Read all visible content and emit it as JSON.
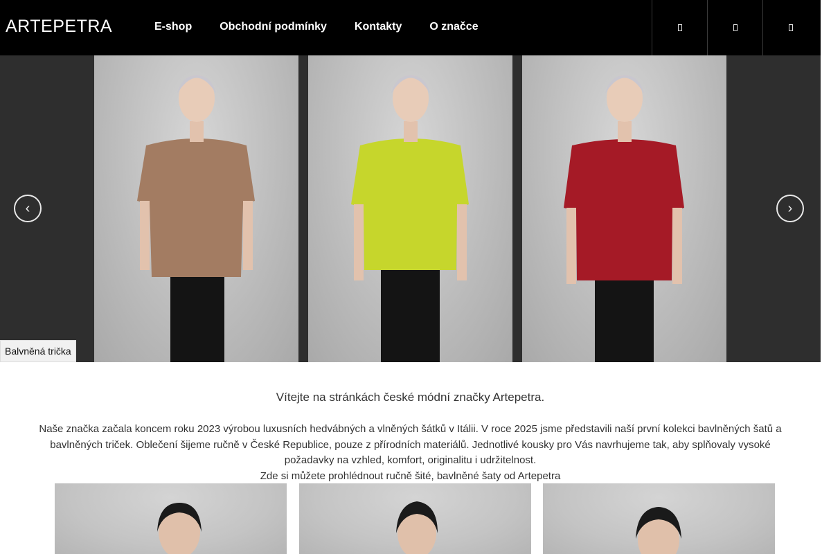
{
  "header": {
    "logo": "ARTEPETRA",
    "nav": [
      {
        "label": "E-shop"
      },
      {
        "label": "Obchodní podmínky"
      },
      {
        "label": "Kontakty"
      },
      {
        "label": "O značce"
      }
    ],
    "icons": [
      "search-icon",
      "user-icon",
      "cart-icon"
    ]
  },
  "slider": {
    "caption": "Balvněná trička",
    "prev_icon": "chevron-left-icon",
    "next_icon": "chevron-right-icon",
    "slides": [
      {
        "shirt_color": "#a37c62"
      },
      {
        "shirt_color": "#c6d62c"
      },
      {
        "shirt_color": "#a51a26"
      }
    ]
  },
  "content": {
    "welcome": "Vítejte na stránkách české módní značky Artepetra.",
    "intro": "Naše značka začala koncem roku 2023 výrobou luxusních hedvábných a vlněných šátků v Itálii. V roce 2025 jsme představili naší první kolekci bavlněných šatů a bavlněných triček. Oblečení šijeme ručně v České Republice, pouze z přírodních materiálů. Jednotlivé kousky pro Vás navrhujeme tak, aby splňovaly vysoké požadavky na vzhled, komfort, originalitu i udržitelnost.",
    "dresses_line": "Zde si můžete prohlédnout ručně šité, bavlněné šaty od Artepetra"
  },
  "colors": {
    "header_bg": "#000000",
    "slider_bg": "#2e2e2e",
    "text": "#333333"
  }
}
